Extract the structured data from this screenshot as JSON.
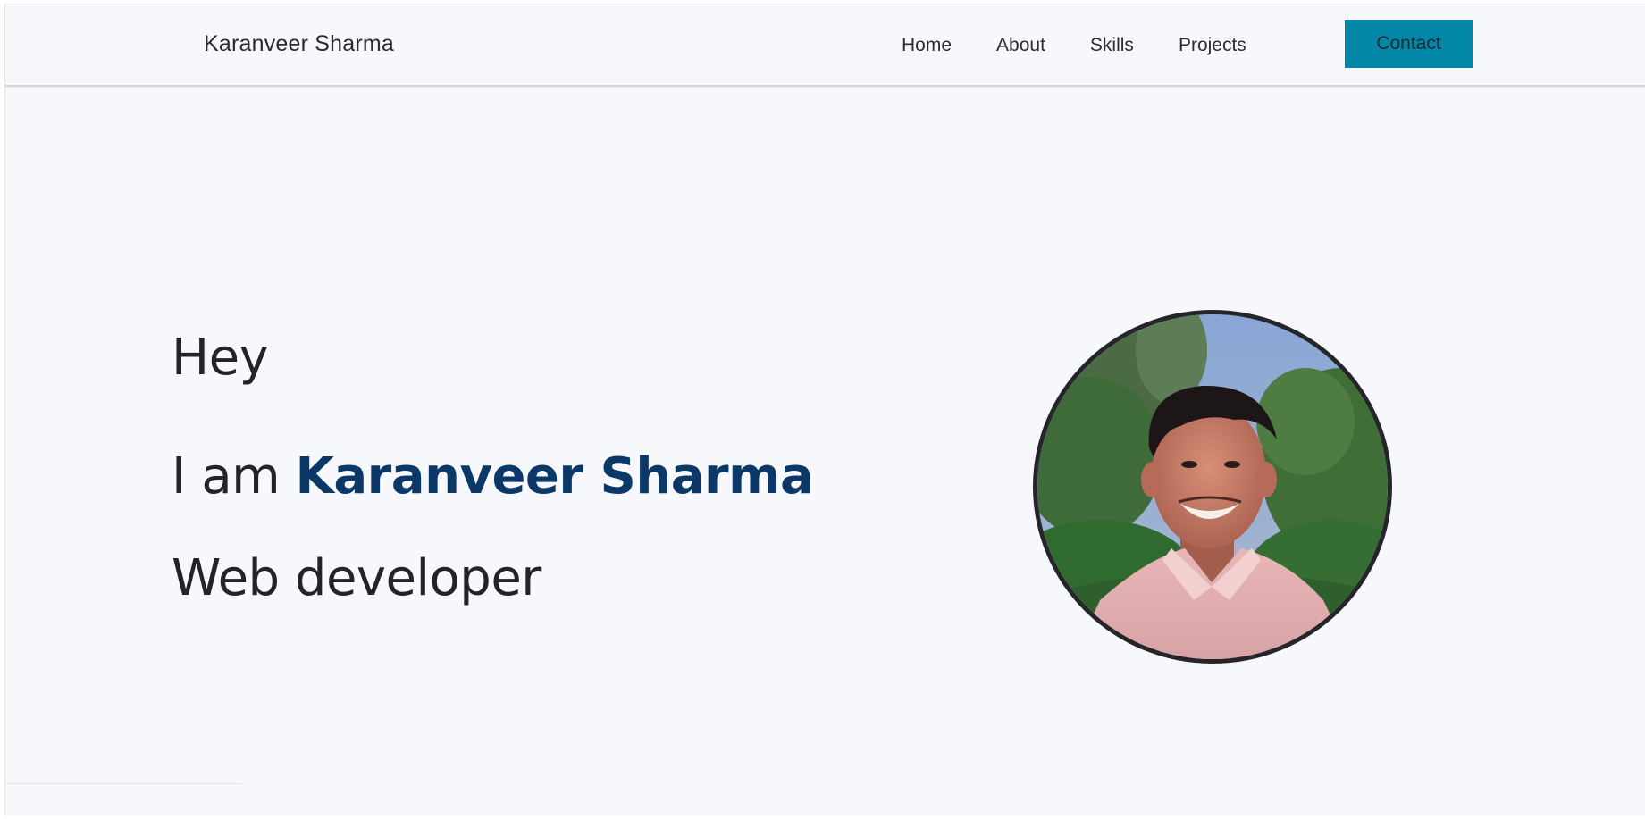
{
  "navbar": {
    "brand": "Karanveer Sharma",
    "links": [
      {
        "label": "Home"
      },
      {
        "label": "About"
      },
      {
        "label": "Skills"
      },
      {
        "label": "Projects"
      }
    ],
    "contact_label": "Contact"
  },
  "hero": {
    "greeting": "Hey",
    "intro_prefix": "I am ",
    "name": "Karanveer Sharma",
    "role": "Web developer"
  },
  "colors": {
    "accent": "#0387a9",
    "name_highlight": "#0b3866",
    "background": "#f7f8fc"
  },
  "icons": {
    "avatar": "profile-photo"
  }
}
